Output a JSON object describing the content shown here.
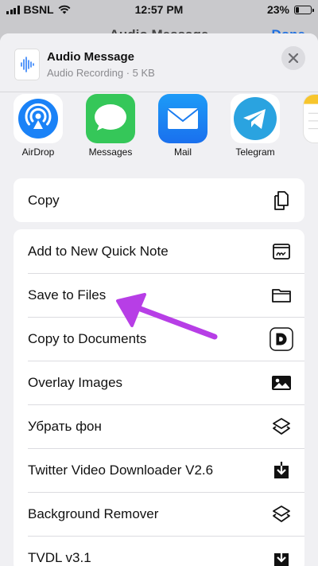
{
  "status_bar": {
    "carrier": "BSNL",
    "time": "12:57 PM",
    "battery": "23%",
    "battery_level": 0.23
  },
  "background_app": {
    "title": "Audio Message",
    "done_label": "Done"
  },
  "file": {
    "title": "Audio Message",
    "subtitle": "Audio Recording · 5 KB"
  },
  "apps": [
    {
      "label": "AirDrop",
      "icon": "airdrop-icon"
    },
    {
      "label": "Messages",
      "icon": "messages-icon"
    },
    {
      "label": "Mail",
      "icon": "mail-icon"
    },
    {
      "label": "Telegram",
      "icon": "telegram-icon"
    }
  ],
  "copy_group": {
    "label": "Copy",
    "icon": "copy-icon"
  },
  "actions": [
    {
      "label": "Add to New Quick Note",
      "icon": "quick-note-icon"
    },
    {
      "label": "Save to Files",
      "icon": "folder-icon"
    },
    {
      "label": "Copy to Documents",
      "icon": "documents-icon"
    },
    {
      "label": "Overlay Images",
      "icon": "photo-icon"
    },
    {
      "label": "Убрать фон",
      "icon": "layers-icon"
    },
    {
      "label": "Twitter Video Downloader V2.6",
      "icon": "download-icon"
    },
    {
      "label": "Background Remover",
      "icon": "layers-icon"
    },
    {
      "label": "TVDL v3.1",
      "icon": "download-icon"
    }
  ],
  "colors": {
    "accent": "#1e6fe0",
    "arrow": "#b73ee6",
    "sheet": "#f0f0f3"
  }
}
